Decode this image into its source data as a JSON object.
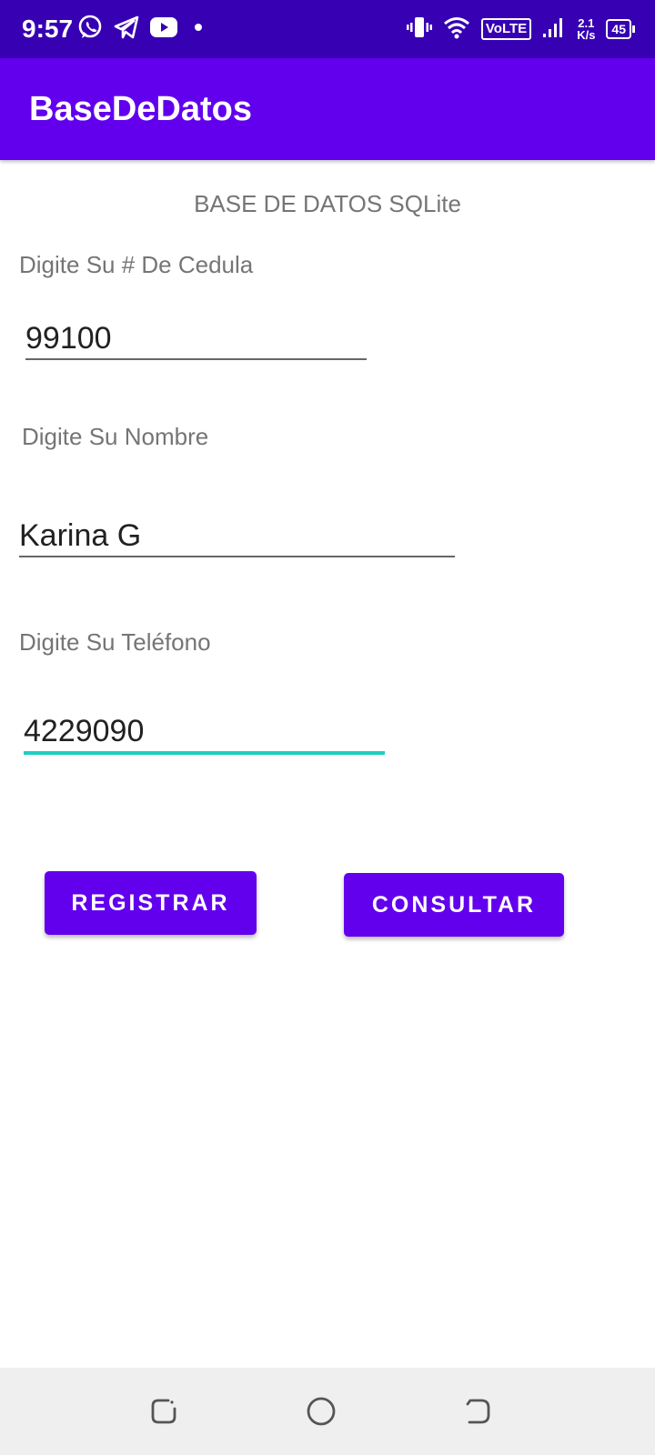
{
  "status_bar": {
    "time": "9:57",
    "volte": "VoLTE",
    "net_speed_value": "2.1",
    "net_speed_unit": "K/s",
    "battery": "45",
    "icons": [
      "whatsapp-icon",
      "telegram-icon",
      "youtube-icon",
      "notification-dot-icon",
      "vibrate-icon",
      "wifi-icon",
      "signal-icon",
      "battery-icon"
    ]
  },
  "app_bar": {
    "title": "BaseDeDatos"
  },
  "main": {
    "heading": "BASE DE DATOS SQLite",
    "cedula": {
      "label": "Digite Su # De Cedula",
      "value": "99100"
    },
    "nombre": {
      "label": "Digite Su Nombre",
      "value": "Karina G"
    },
    "telefono": {
      "label": "Digite Su Teléfono",
      "value": "4229090"
    },
    "buttons": {
      "register": "REGISTRAR",
      "consult": "CONSULTAR"
    }
  },
  "colors": {
    "status_bar": "#3700b3",
    "primary": "#6200ee",
    "focus_accent": "#1ccfc3",
    "label_text": "#757575",
    "input_text": "#212121",
    "nav_bar": "#efefef"
  },
  "nav_bar": {
    "icons": [
      "recents-icon",
      "home-icon",
      "back-icon"
    ]
  }
}
